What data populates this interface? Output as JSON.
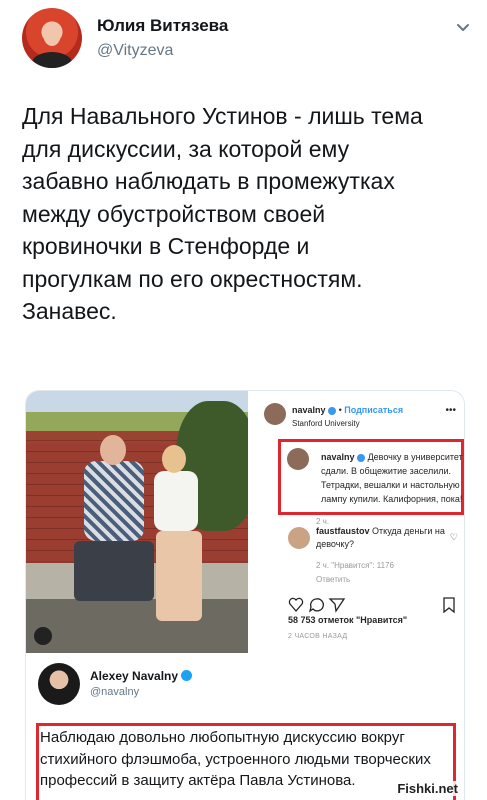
{
  "tweet": {
    "author_name": "Юлия Витязева",
    "author_handle": "@Vityzeva",
    "text_lines": [
      "Для Навального Устинов - лишь тема",
      "для дискуссии, за которой ему",
      "забавно наблюдать в промежутках",
      "между обустройством своей",
      "кровиночки в Стенфорде и",
      "прогулкам по его окрестностям.",
      "Занавес."
    ]
  },
  "instagram": {
    "username": "navalny",
    "follow_label": "Подписаться",
    "location": "Stanford University",
    "caption_user": "navalny",
    "caption_text": "Девочку в университет сдали. В общежитие заселили. Тетрадки, вешалки и настольную лампу купили. Калифорния, пока!",
    "caption_time": "2 ч.",
    "commenter": "faustfaustov",
    "comment_text": "Откуда деньги на девочку?",
    "comment_meta": "2 ч.     \"Нравится\": 1176",
    "reply_label": "Ответить",
    "likes": "58 753 отметок \"Нравится\"",
    "posted_ago": "2 ЧАСОВ НАЗАД"
  },
  "quoted_tweet": {
    "name": "Alexey Navalny",
    "handle": "@navalny",
    "text": "Наблюдаю довольно любопытную дискуссию вокруг стихийного флэшмоба, устроенного людьми творческих профессий в защиту актёра Павла Устинова."
  },
  "watermark": "Fishki.net",
  "colors": {
    "highlight_border": "#e0262e",
    "verified_blue": "#1da1f2",
    "link_blue": "#3897f0"
  }
}
